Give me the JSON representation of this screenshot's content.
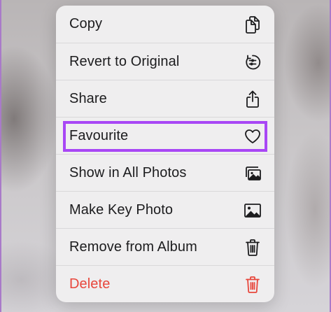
{
  "context_menu": {
    "items": [
      {
        "label": "Copy",
        "icon": "copy-icon",
        "destructive": false
      },
      {
        "label": "Revert to Original",
        "icon": "revert-icon",
        "destructive": false
      },
      {
        "label": "Share",
        "icon": "share-icon",
        "destructive": false
      },
      {
        "label": "Favourite",
        "icon": "heart-icon",
        "destructive": false,
        "highlighted": true
      },
      {
        "label": "Show in All Photos",
        "icon": "photos-icon",
        "destructive": false
      },
      {
        "label": "Make Key Photo",
        "icon": "photo-icon",
        "destructive": false
      },
      {
        "label": "Remove from Album",
        "icon": "trash-icon",
        "destructive": false
      },
      {
        "label": "Delete",
        "icon": "trash-icon",
        "destructive": true
      }
    ]
  },
  "colors": {
    "highlight_border": "#a847f5",
    "destructive": "#e8473c",
    "menu_background": "#efeeef"
  }
}
